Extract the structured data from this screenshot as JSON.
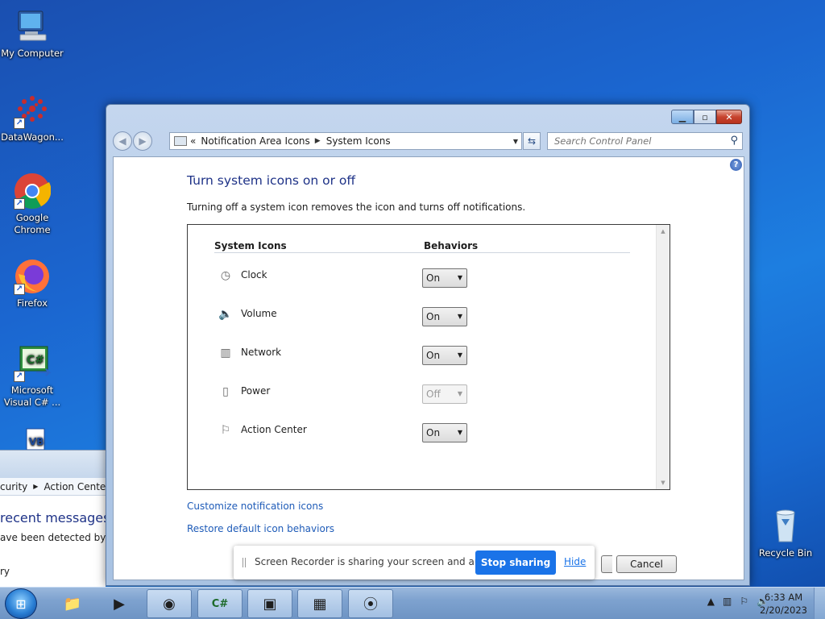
{
  "desktop": {
    "icons": [
      {
        "label": "My Computer",
        "icon": "computer-icon"
      },
      {
        "label": "DataWagon...",
        "icon": "datawagon-icon"
      },
      {
        "label": "Google Chrome",
        "icon": "chrome-icon"
      },
      {
        "label": "Firefox",
        "icon": "firefox-icon"
      },
      {
        "label": "Microsoft Visual C# ...",
        "icon": "visual-csharp-icon"
      },
      {
        "label": "",
        "icon": "visual-basic-icon"
      },
      {
        "label": "Recycle Bin",
        "icon": "recycle-bin-icon"
      }
    ]
  },
  "background_window": {
    "breadcrumb_left": "curity",
    "breadcrumb_current": "Action Center",
    "heading": "recent messages an",
    "text": "ave been detected by Ac",
    "fragment": "ry"
  },
  "window": {
    "address": {
      "crumb1": "Notification Area Icons",
      "crumb2": "System Icons",
      "chevrons": "«"
    },
    "search": {
      "placeholder": "Search Control Panel"
    },
    "help": "?",
    "title": "Turn system icons on or off",
    "description": "Turning off a system icon removes the icon and turns off notifications.",
    "columns": {
      "icons": "System Icons",
      "behaviors": "Behaviors"
    },
    "rows": [
      {
        "label": "Clock",
        "value": "On",
        "enabled": true
      },
      {
        "label": "Volume",
        "value": "On",
        "enabled": true
      },
      {
        "label": "Network",
        "value": "On",
        "enabled": true
      },
      {
        "label": "Power",
        "value": "Off",
        "enabled": false
      },
      {
        "label": "Action Center",
        "value": "On",
        "enabled": true
      }
    ],
    "links": {
      "customize": "Customize notification icons",
      "restore": "Restore default icon behaviors"
    },
    "buttons": {
      "cancel": "Cancel"
    }
  },
  "recorder": {
    "message": "Screen Recorder is sharing your screen and audio.",
    "stop": "Stop sharing",
    "hide": "Hide"
  },
  "taskbar": {
    "time": "6:33 AM",
    "date": "2/20/2023"
  }
}
